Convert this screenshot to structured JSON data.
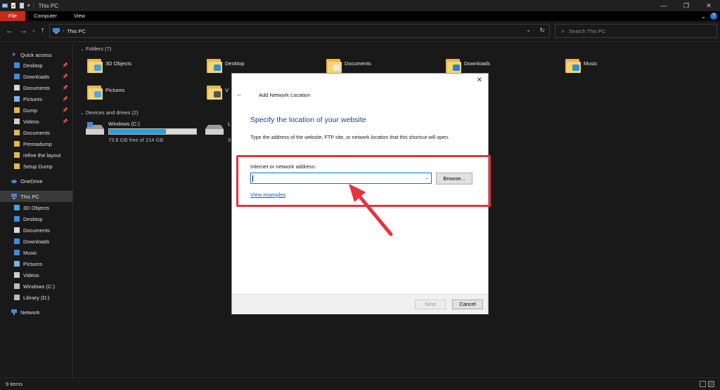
{
  "window": {
    "title": "This PC"
  },
  "ribbon": {
    "tabs": [
      "File",
      "Computer",
      "View"
    ],
    "help": "?"
  },
  "address": {
    "path": "This PC"
  },
  "search": {
    "placeholder": "Search This PC"
  },
  "sidebar": {
    "quick_access": "Quick access",
    "quick_items": [
      {
        "label": "Desktop",
        "pinned": true,
        "icon": "desktop-icon"
      },
      {
        "label": "Downloads",
        "pinned": true,
        "icon": "download-icon"
      },
      {
        "label": "Documents",
        "pinned": true,
        "icon": "document-icon"
      },
      {
        "label": "Pictures",
        "pinned": true,
        "icon": "picture-icon"
      },
      {
        "label": "Dump",
        "pinned": true,
        "icon": "folder-icon"
      },
      {
        "label": "Videos",
        "pinned": true,
        "icon": "video-icon"
      },
      {
        "label": "Documents",
        "pinned": false,
        "icon": "folder-icon"
      },
      {
        "label": "Permadump",
        "pinned": false,
        "icon": "folder-icon"
      },
      {
        "label": "refine the layout",
        "pinned": false,
        "icon": "folder-icon"
      },
      {
        "label": "Setup Dump",
        "pinned": false,
        "icon": "folder-icon"
      }
    ],
    "onedrive": "OneDrive",
    "this_pc": "This PC",
    "pc_items": [
      {
        "label": "3D Objects",
        "icon": "cube-icon"
      },
      {
        "label": "Desktop",
        "icon": "desktop-icon"
      },
      {
        "label": "Documents",
        "icon": "document-icon"
      },
      {
        "label": "Downloads",
        "icon": "download-icon"
      },
      {
        "label": "Music",
        "icon": "music-icon"
      },
      {
        "label": "Pictures",
        "icon": "picture-icon"
      },
      {
        "label": "Videos",
        "icon": "video-icon"
      },
      {
        "label": "Windows (C:)",
        "icon": "drive-icon"
      },
      {
        "label": "Library (D:)",
        "icon": "drive-icon"
      }
    ],
    "network": "Network"
  },
  "content": {
    "folders_header": "Folders (7)",
    "folders": [
      {
        "label": "3D Objects",
        "badge": "#4aa3df"
      },
      {
        "label": "Desktop",
        "badge": "#2f8fd8"
      },
      {
        "label": "Documents",
        "badge": "#e8e8e8"
      },
      {
        "label": "Downloads",
        "badge": "#2f7fd0"
      },
      {
        "label": "Music",
        "badge": "#2f8fd8"
      },
      {
        "label": "Pictures",
        "badge": "#58a7e0"
      },
      {
        "label": "V",
        "badge": "#555"
      }
    ],
    "drives_header": "Devices and drives (2)",
    "drives": [
      {
        "name": "Windows (C:)",
        "free": "73.8 GB free of 214 GB",
        "used_fraction": 0.655
      },
      {
        "name": "L",
        "free": "9",
        "used_fraction": 0
      }
    ]
  },
  "dialog": {
    "title": "Add Network Location",
    "heading": "Specify the location of your website",
    "description": "Type the address of the website, FTP site, or network location that this shortcut will open.",
    "address_label": "Internet or network address:",
    "address_value": "",
    "browse": "Browse...",
    "view_examples": "View examples",
    "next": "Next",
    "cancel": "Cancel"
  },
  "status": {
    "items": "9 items"
  },
  "colors": {
    "accent": "#0078d7",
    "highlight": "#e8323c",
    "file_tab": "#c42b1c",
    "heading": "#1c3f94"
  }
}
